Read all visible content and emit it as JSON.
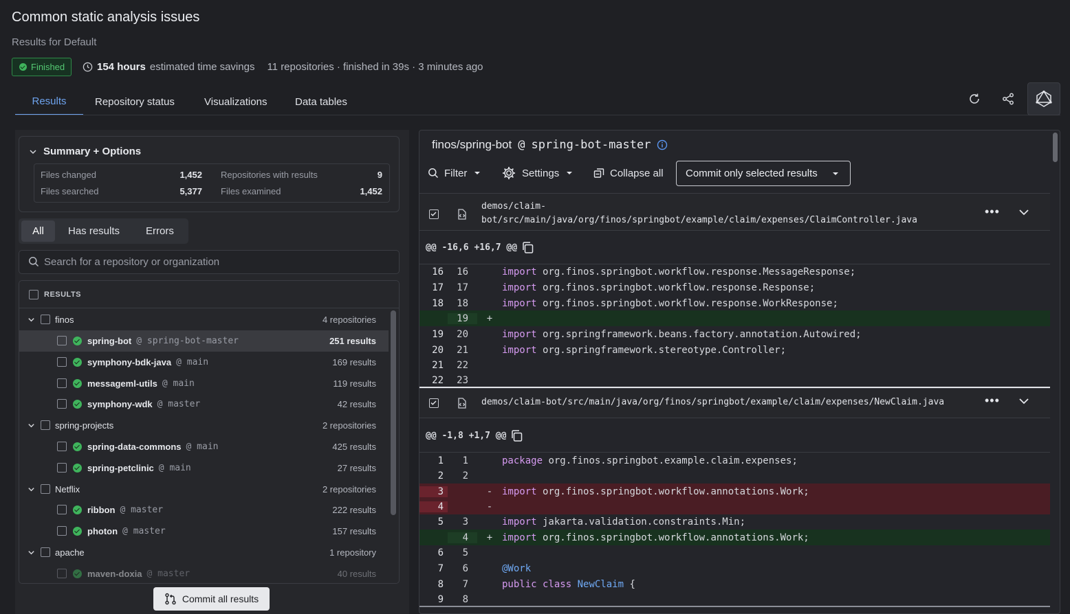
{
  "header": {
    "title": "Common static analysis issues",
    "subtitle": "Results for Default",
    "status": "Finished",
    "hours": "154 hours",
    "savings": "estimated time savings",
    "meta": "11 repositories · finished in 39s · 3 minutes ago"
  },
  "tabs": [
    "Results",
    "Repository status",
    "Visualizations",
    "Data tables"
  ],
  "summary": {
    "title": "Summary + Options",
    "files_changed_label": "Files changed",
    "files_changed": "1,452",
    "files_searched_label": "Files searched",
    "files_searched": "5,377",
    "repos_with_results_label": "Repositories with results",
    "repos_with_results": "9",
    "files_examined_label": "Files examined",
    "files_examined": "1,452"
  },
  "filters": [
    "All",
    "Has results",
    "Errors"
  ],
  "search": {
    "placeholder": "Search for a repository or organization"
  },
  "results_header": "RESULTS",
  "tree": [
    {
      "kind": "org",
      "name": "finos",
      "count": "4 repositories"
    },
    {
      "kind": "repo",
      "name": "spring-bot",
      "branch": "@ spring-bot-master",
      "count": "251 results",
      "selected": true
    },
    {
      "kind": "repo",
      "name": "symphony-bdk-java",
      "branch": "@ main",
      "count": "169 results"
    },
    {
      "kind": "repo",
      "name": "messageml-utils",
      "branch": "@ main",
      "count": "119 results"
    },
    {
      "kind": "repo",
      "name": "symphony-wdk",
      "branch": "@ master",
      "count": "42 results"
    },
    {
      "kind": "org",
      "name": "spring-projects",
      "count": "2 repositories"
    },
    {
      "kind": "repo",
      "name": "spring-data-commons",
      "branch": "@ main",
      "count": "425 results"
    },
    {
      "kind": "repo",
      "name": "spring-petclinic",
      "branch": "@ main",
      "count": "27 results"
    },
    {
      "kind": "org",
      "name": "Netflix",
      "count": "2 repositories"
    },
    {
      "kind": "repo",
      "name": "ribbon",
      "branch": "@ master",
      "count": "222 results"
    },
    {
      "kind": "repo",
      "name": "photon",
      "branch": "@ master",
      "count": "157 results"
    },
    {
      "kind": "org",
      "name": "apache",
      "count": "1 repository"
    },
    {
      "kind": "repo",
      "name": "maven-doxia",
      "branch": "@ master",
      "count": "40 results"
    }
  ],
  "commit_all": "Commit all results",
  "detail": {
    "repo": "finos/spring-bot",
    "at": "@",
    "branch": "spring-bot-master",
    "filter": "Filter",
    "settings": "Settings",
    "collapse": "Collapse all",
    "commit_selected": "Commit only selected results",
    "file1": {
      "path_line1": "demos/claim-",
      "path_line2": "bot/src/main/java/org/finos/springbot/example/claim/expenses/ClaimController.java",
      "hunk": "@@ -16,6 +16,7 @@"
    },
    "file2": {
      "path": "demos/claim-bot/src/main/java/org/finos/springbot/example/claim/expenses/NewClaim.java",
      "hunk": "@@ -1,8 +1,7 @@"
    }
  },
  "diff1": [
    {
      "o": "16",
      "n": "16",
      "s": "",
      "kw": "import",
      "rest": " org.finos.springbot.workflow.response.MessageResponse;",
      "t": ""
    },
    {
      "o": "17",
      "n": "17",
      "s": "",
      "kw": "import",
      "rest": " org.finos.springbot.workflow.response.Response;",
      "t": ""
    },
    {
      "o": "18",
      "n": "18",
      "s": "",
      "kw": "import",
      "rest": " org.finos.springbot.workflow.response.WorkResponse;",
      "t": ""
    },
    {
      "o": "",
      "n": "19",
      "s": "+",
      "kw": "",
      "rest": "",
      "t": "add"
    },
    {
      "o": "19",
      "n": "20",
      "s": "",
      "kw": "import",
      "rest": " org.springframework.beans.factory.annotation.Autowired;",
      "t": ""
    },
    {
      "o": "20",
      "n": "21",
      "s": "",
      "kw": "import",
      "rest": " org.springframework.stereotype.Controller;",
      "t": ""
    },
    {
      "o": "21",
      "n": "22",
      "s": "",
      "kw": "",
      "rest": "",
      "t": ""
    },
    {
      "o": "22",
      "n": "23",
      "s": "",
      "kw": "",
      "rest": "",
      "t": ""
    }
  ],
  "diff2": [
    {
      "o": "1",
      "n": "1",
      "s": "",
      "kw": "package",
      "rest": " org.finos.springbot.example.claim.expenses;",
      "t": ""
    },
    {
      "o": "2",
      "n": "2",
      "s": "",
      "kw": "",
      "rest": "",
      "t": ""
    },
    {
      "o": "3",
      "n": "",
      "s": "-",
      "kw": "import",
      "rest": " org.finos.springbot.workflow.annotations.Work;",
      "t": "del"
    },
    {
      "o": "4",
      "n": "",
      "s": "-",
      "kw": "",
      "rest": "",
      "t": "del"
    },
    {
      "o": "5",
      "n": "3",
      "s": "",
      "kw": "import",
      "rest": " jakarta.validation.constraints.Min;",
      "t": ""
    },
    {
      "o": "",
      "n": "4",
      "s": "+",
      "kw": "import",
      "rest": " org.finos.springbot.workflow.annotations.Work;",
      "t": "add"
    },
    {
      "o": "6",
      "n": "5",
      "s": "",
      "kw": "",
      "rest": "",
      "t": ""
    },
    {
      "o": "7",
      "n": "6",
      "s": "",
      "kw": "",
      "rest": "",
      "ty": "@Work",
      "t": ""
    },
    {
      "o": "8",
      "n": "7",
      "s": "",
      "kw": "public class",
      "rest": " {",
      "ty2": "NewClaim",
      "t": ""
    },
    {
      "o": "9",
      "n": "8",
      "s": "",
      "kw": "",
      "rest": "",
      "t": ""
    }
  ]
}
